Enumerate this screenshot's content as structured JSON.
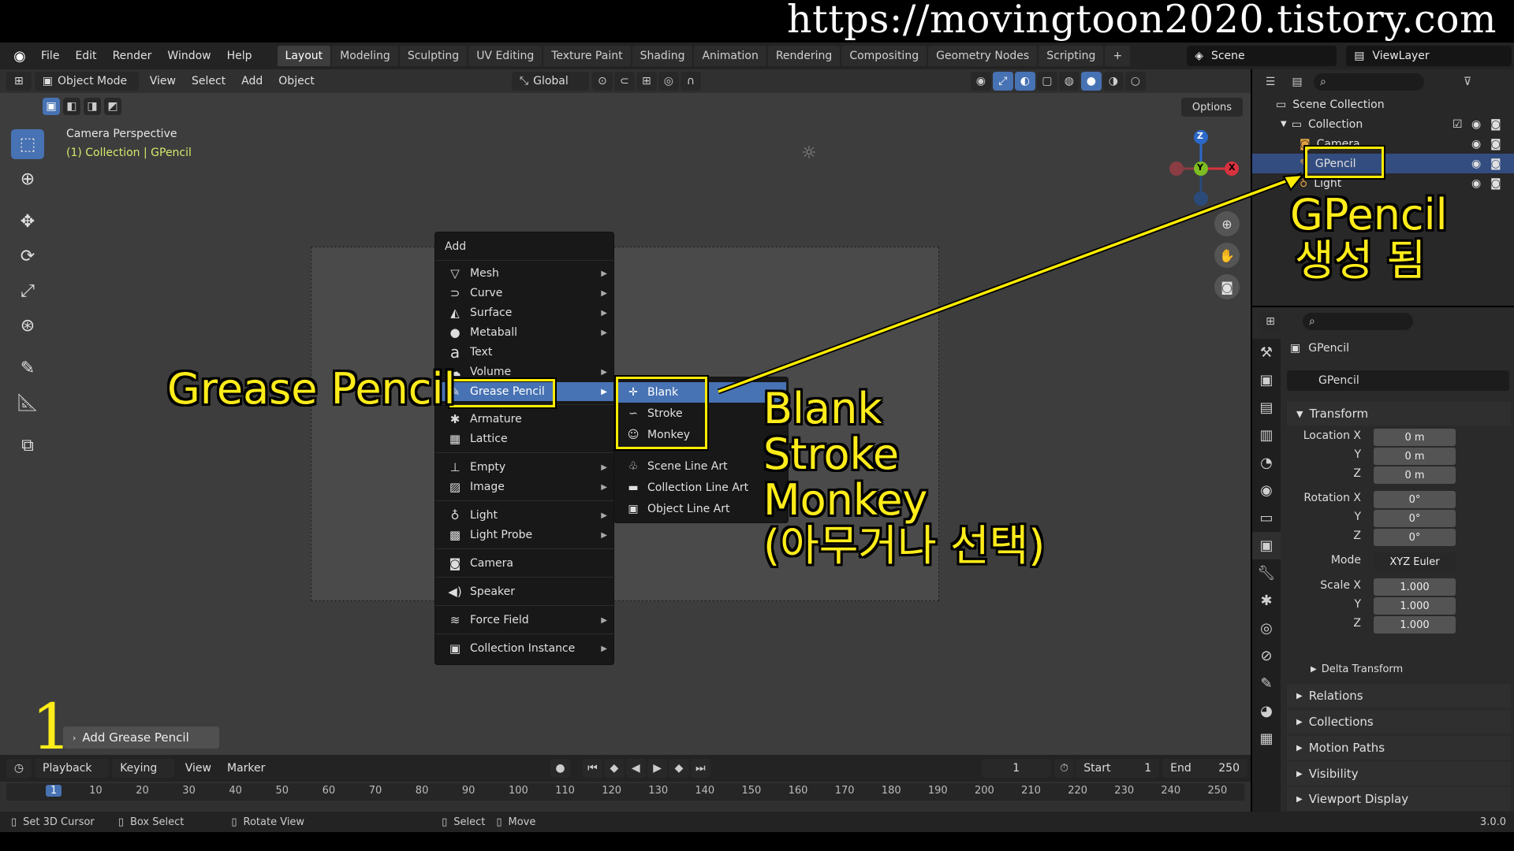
{
  "watermark": "https://movingtoon2020.tistory.com",
  "menubar": {
    "items": [
      "File",
      "Edit",
      "Render",
      "Window",
      "Help"
    ],
    "tabs": [
      "Layout",
      "Modeling",
      "Sculpting",
      "UV Editing",
      "Texture Paint",
      "Shading",
      "Animation",
      "Rendering",
      "Compositing",
      "Geometry Nodes",
      "Scripting"
    ],
    "scene": "Scene",
    "view_layer": "ViewLayer"
  },
  "header": {
    "mode": "Object Mode",
    "menus": [
      "View",
      "Select",
      "Add",
      "Object"
    ],
    "orientation": "Global",
    "options": "Options"
  },
  "viewport": {
    "camera_label": "Camera Perspective",
    "collection_label": "(1) Collection | GPencil",
    "gizmo": {
      "z": "Z",
      "y": "Y",
      "x": "X"
    }
  },
  "add_menu": {
    "title": "Add",
    "items": [
      {
        "label": "Mesh",
        "icon": "mesh-icon",
        "sub": true
      },
      {
        "label": "Curve",
        "icon": "curve-icon",
        "sub": true
      },
      {
        "label": "Surface",
        "icon": "surface-icon",
        "sub": true
      },
      {
        "label": "Metaball",
        "icon": "metaball-icon",
        "sub": true
      },
      {
        "label": "Text",
        "icon": "text-icon",
        "sub": false
      },
      {
        "label": "Volume",
        "icon": "volume-icon",
        "sub": true
      },
      {
        "label": "Grease Pencil",
        "icon": "grease-pencil-icon",
        "sub": true
      },
      {
        "label": "Armature",
        "icon": "armature-icon",
        "sub": false
      },
      {
        "label": "Lattice",
        "icon": "lattice-icon",
        "sub": false
      },
      {
        "label": "Empty",
        "icon": "empty-icon",
        "sub": true
      },
      {
        "label": "Image",
        "icon": "image-icon",
        "sub": true
      },
      {
        "label": "Light",
        "icon": "light-icon",
        "sub": true
      },
      {
        "label": "Light Probe",
        "icon": "light-probe-icon",
        "sub": true
      },
      {
        "label": "Camera",
        "icon": "camera-icon",
        "sub": false
      },
      {
        "label": "Speaker",
        "icon": "speaker-icon",
        "sub": false
      },
      {
        "label": "Force Field",
        "icon": "force-field-icon",
        "sub": true
      },
      {
        "label": "Collection Instance",
        "icon": "collection-instance-icon",
        "sub": true
      }
    ]
  },
  "gp_submenu": {
    "items": [
      "Blank",
      "Stroke",
      "Monkey",
      "Scene Line Art",
      "Collection Line Art",
      "Object Line Art"
    ]
  },
  "annotations": {
    "grease": "Grease Pencil",
    "choices": [
      "Blank",
      "Stroke",
      "Monkey",
      "(아무거나 선택)"
    ],
    "gpencil_title": "GPencil",
    "gpencil_sub": "생성 됨",
    "step": "1"
  },
  "last_op": "Add Grease Pencil",
  "timeline": {
    "menus": [
      "Playback",
      "Keying",
      "View",
      "Marker"
    ],
    "frame": "1",
    "start_label": "Start",
    "start": "1",
    "end_label": "End",
    "end": "250",
    "ticks": [
      "1",
      "10",
      "20",
      "30",
      "40",
      "50",
      "60",
      "70",
      "80",
      "90",
      "100",
      "110",
      "120",
      "130",
      "140",
      "150",
      "160",
      "170",
      "180",
      "190",
      "200",
      "210",
      "220",
      "230",
      "240",
      "250"
    ]
  },
  "status": {
    "items": [
      "Set 3D Cursor",
      "Box Select",
      "Rotate View",
      "Select",
      "Move"
    ],
    "version": "3.0.0"
  },
  "outliner": {
    "root": "Scene Collection",
    "collection": "Collection",
    "items": [
      "Camera",
      "GPencil",
      "Light"
    ]
  },
  "properties": {
    "object": "GPencil",
    "object_name": "GPencil",
    "transform": "Transform",
    "loc_label": "Location X",
    "rot_label": "Rotation X",
    "scale_label": "Scale X",
    "y": "Y",
    "z": "Z",
    "loc": [
      "0 m",
      "0 m",
      "0 m"
    ],
    "rot": [
      "0°",
      "0°",
      "0°"
    ],
    "mode_label": "Mode",
    "mode": "XYZ Euler",
    "scale": [
      "1.000",
      "1.000",
      "1.000"
    ],
    "delta": "Delta Transform",
    "sections": [
      "Relations",
      "Collections",
      "Motion Paths",
      "Visibility",
      "Viewport Display"
    ]
  }
}
